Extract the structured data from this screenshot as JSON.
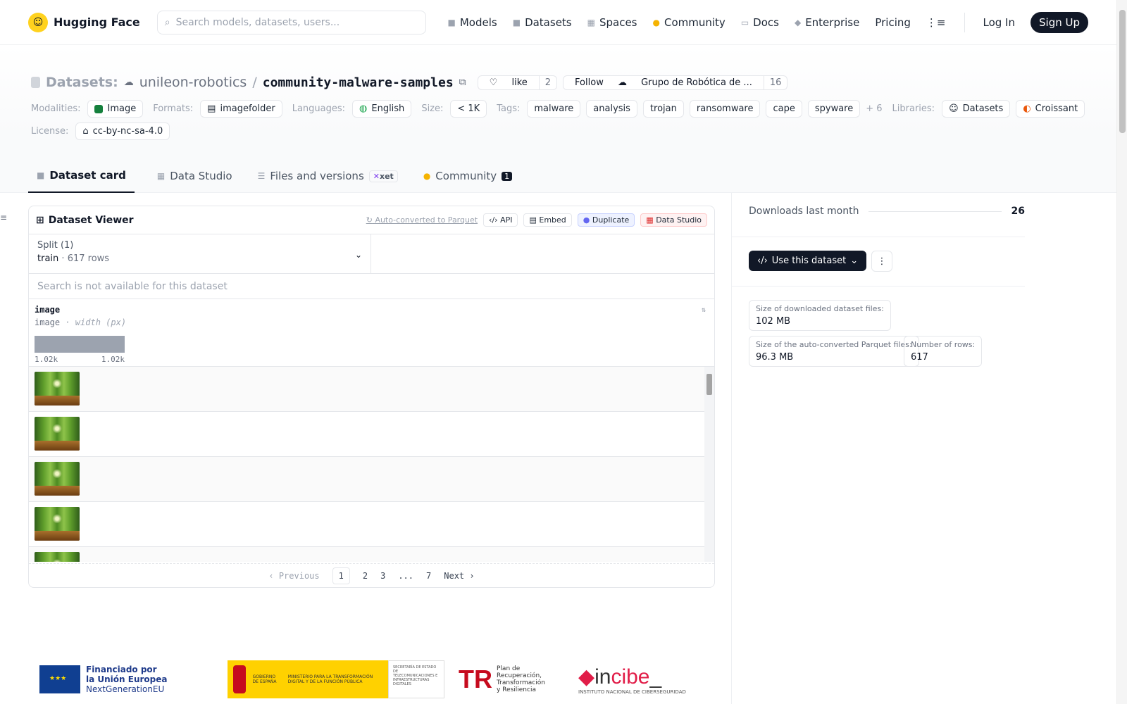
{
  "nav": {
    "brand": "Hugging Face",
    "search_placeholder": "Search models, datasets, users...",
    "links": [
      "Models",
      "Datasets",
      "Spaces",
      "Community",
      "Docs",
      "Enterprise",
      "Pricing"
    ],
    "login": "Log In",
    "signup": "Sign Up"
  },
  "repo": {
    "label": "Datasets:",
    "org": "unileon-robotics",
    "sep": "/",
    "name": "community-malware-samples",
    "like_label": "like",
    "like_count": "2",
    "follow_label": "Follow",
    "follow_org": "Grupo de Robótica de ...",
    "follow_count": "16"
  },
  "meta": {
    "modalities_label": "Modalities:",
    "modality": "Image",
    "formats_label": "Formats:",
    "format": "imagefolder",
    "languages_label": "Languages:",
    "language": "English",
    "size_label": "Size:",
    "size": "< 1K",
    "tags_label": "Tags:",
    "tags": [
      "malware",
      "analysis",
      "trojan",
      "ransomware",
      "cape",
      "spyware"
    ],
    "tags_more": "+ 6",
    "libraries_label": "Libraries:",
    "libraries": [
      "Datasets",
      "Croissant"
    ],
    "license_label": "License:",
    "license": "cc-by-nc-sa-4.0"
  },
  "tabs": {
    "card": "Dataset card",
    "studio": "Data Studio",
    "files": "Files and versions",
    "xet": "xet",
    "community": "Community",
    "community_count": "1"
  },
  "viewer": {
    "title": "Dataset Viewer",
    "autoconv": "Auto-converted to Parquet",
    "api": "API",
    "embed": "Embed",
    "duplicate": "Duplicate",
    "studio": "Data Studio",
    "split_label": "Split (1)",
    "split_name": "train",
    "split_dot": "·",
    "split_rows": "617 rows",
    "search_na": "Search is not available for this dataset",
    "col_name": "image",
    "col_type": "image",
    "col_sub": "· width (px)",
    "hist_min": "1.02k",
    "hist_max": "1.02k",
    "pager": {
      "prev": "Previous",
      "pages": [
        "1",
        "2",
        "3",
        "...",
        "7"
      ],
      "next": "Next"
    }
  },
  "sidebar": {
    "downloads_label": "Downloads last month",
    "downloads": "26",
    "use_btn": "Use this dataset",
    "stats": {
      "dl_size_label": "Size of downloaded dataset files:",
      "dl_size": "102 MB",
      "parquet_label": "Size of the auto-converted Parquet files:",
      "parquet": "96.3 MB",
      "rows_label": "Number of rows:",
      "rows": "617"
    }
  },
  "footer": {
    "eu_line1": "Financiado por",
    "eu_line2": "la Unión Europea",
    "eu_line3": "NextGenerationEU",
    "gob1": "GOBIERNO DE ESPAÑA",
    "gob2": "MINISTERIO PARA LA TRANSFORMACIÓN DIGITAL Y DE LA FUNCIÓN PÚBLICA",
    "gob3": "SECRETARÍA DE ESTADO DE TELECOMUNICACIONES E INFRAESTRUCTURAS DIGITALES",
    "prtr_mark": "TR",
    "prtr1": "Plan de",
    "prtr2": "Recuperación,",
    "prtr3": "Transformación",
    "prtr4": "y Resiliencia",
    "incibe_a": "in",
    "incibe_b": "cibe",
    "incibe_c": "_",
    "incibe_sub": "INSTITUTO NACIONAL DE CIBERSEGURIDAD"
  }
}
